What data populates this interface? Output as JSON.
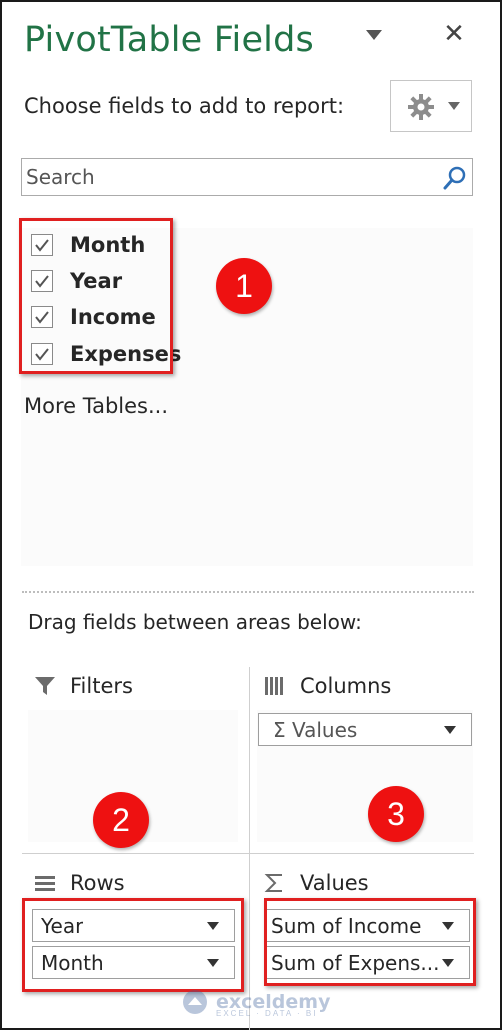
{
  "pane": {
    "title": "PivotTable Fields",
    "close_glyph": "✕",
    "choose_label": "Choose fields to add to report:",
    "tools_icon": "gear-icon"
  },
  "search": {
    "placeholder": "Search"
  },
  "fields": [
    {
      "label": "Month",
      "checked": true
    },
    {
      "label": "Year",
      "checked": true
    },
    {
      "label": "Income",
      "checked": true
    },
    {
      "label": "Expenses",
      "checked": true
    }
  ],
  "more_tables": "More Tables...",
  "drag_label": "Drag fields between areas below:",
  "areas": {
    "filters": {
      "title": "Filters",
      "icon": "filter-icon"
    },
    "columns": {
      "title": "Columns",
      "icon": "columns-icon",
      "items": [
        {
          "label": "Σ  Values"
        }
      ]
    },
    "rows": {
      "title": "Rows",
      "icon": "rows-icon",
      "items": [
        {
          "label": "Year"
        },
        {
          "label": "Month"
        }
      ]
    },
    "values": {
      "title": "Values",
      "icon": "sigma-icon",
      "items": [
        {
          "label": "Sum of Income"
        },
        {
          "label": "Sum of Expens..."
        }
      ]
    }
  },
  "badges": [
    "1",
    "2",
    "3"
  ],
  "watermark": {
    "name": "exceldemy",
    "tagline": "EXCEL · DATA · BI"
  },
  "colors": {
    "title_green": "#217346",
    "highlight_red": "#e02020",
    "badge_red": "#ee1111"
  }
}
